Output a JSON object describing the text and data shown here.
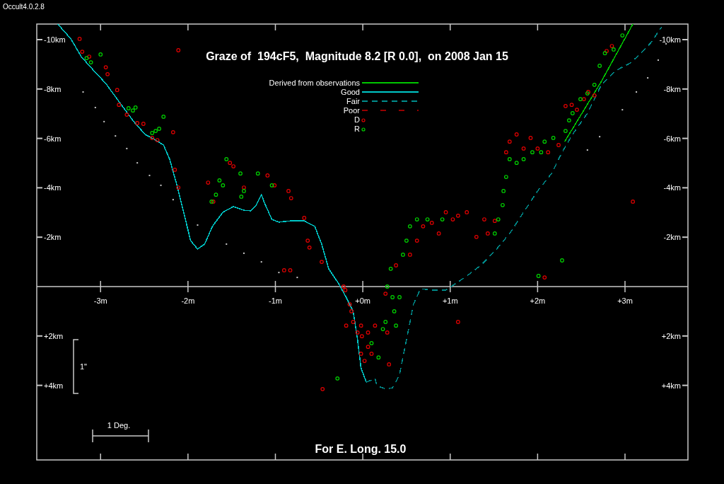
{
  "app_version": "Occult4.0.2.8",
  "charts": [
    {
      "chart_data": {
        "type": "line",
        "title": "Graze of  194cF5,  Magnitude 8.2 [R 0.0],  on 2008 Jan 15",
        "xticks": [
          {
            "value": -3,
            "label": "-3m"
          },
          {
            "value": -2,
            "label": "-2m"
          },
          {
            "value": -1,
            "label": "-1m"
          },
          {
            "value": 0,
            "label": "+0m"
          },
          {
            "value": 1,
            "label": "+1m"
          },
          {
            "value": 2,
            "label": "+2m"
          },
          {
            "value": 3,
            "label": "+3m"
          }
        ],
        "yticks": [
          {
            "value": -10,
            "label": "-10km"
          },
          {
            "value": -8,
            "label": "-8km"
          },
          {
            "value": -6,
            "label": "-6km"
          },
          {
            "value": -4,
            "label": "-4km"
          },
          {
            "value": -2,
            "label": "-2km"
          },
          {
            "value": 2,
            "label": "+2km"
          },
          {
            "value": 4,
            "label": "+4km"
          }
        ],
        "y2ticks": [
          {
            "value": -10,
            "label": "-10km"
          },
          {
            "value": -8,
            "label": "-8km"
          },
          {
            "value": -6,
            "label": "-6km"
          },
          {
            "value": -4,
            "label": "-4km"
          },
          {
            "value": -2,
            "label": "-2km"
          },
          {
            "value": 2,
            "label": "+2km"
          },
          {
            "value": 4,
            "label": "+4km"
          }
        ],
        "xlim": [
          -3.73,
          3.72
        ],
        "ylim": [
          7.02,
          -10.63
        ],
        "y2lim": [
          7.02,
          -10.63
        ],
        "legend": "top",
        "series": [
          {
            "name": "Derived from observations",
            "line_style": "solid",
            "color": "#00c800",
            "x": [
              2.31,
              2.73,
              3.09
            ],
            "values": [
              -5.87,
              -8.31,
              -10.63
            ]
          },
          {
            "name": "Good",
            "line_style": "solid",
            "color": "#00c8c8",
            "x": [
              -3.49,
              -3.34,
              -3.22,
              -3.1,
              -2.94,
              -2.78,
              -2.62,
              -2.49,
              -2.37,
              -2.28,
              -2.21,
              -2.13,
              -2.05,
              -1.97,
              -1.89,
              -1.81,
              -1.72,
              -1.6,
              -1.48,
              -1.36,
              -1.28,
              -1.22,
              -1.16,
              -1.12,
              -1.04,
              -0.96,
              -0.83,
              -0.67,
              -0.55,
              -0.47,
              -0.39,
              -0.28,
              -0.19,
              -0.11,
              -0.06,
              -0.02,
              0.04
            ],
            "values": [
              -10.63,
              -10.03,
              -9.31,
              -8.83,
              -8.22,
              -7.45,
              -6.68,
              -6.16,
              -5.93,
              -5.73,
              -5.16,
              -4.15,
              -3.01,
              -1.86,
              -1.52,
              -1.72,
              -2.44,
              -3.01,
              -3.24,
              -3.09,
              -3.07,
              -3.3,
              -3.72,
              -3.35,
              -2.72,
              -2.61,
              -2.66,
              -2.66,
              -2.44,
              -1.72,
              -0.72,
              -0.14,
              0.43,
              1.0,
              2.15,
              3.3,
              3.87
            ]
          },
          {
            "name": "Fair",
            "line_style": "dashed",
            "color": "#008c8c",
            "x": [
              0.04,
              0.14,
              0.16,
              0.26,
              0.34,
              0.42,
              0.5,
              0.58,
              0.66,
              0.79,
              0.95,
              1.07,
              1.19,
              1.35,
              1.51,
              1.68,
              1.84,
              2.0,
              2.16,
              2.28,
              2.4,
              2.57,
              2.73,
              2.89,
              3.05,
              3.17,
              3.3,
              3.42
            ],
            "values": [
              3.87,
              3.72,
              4.01,
              4.15,
              4.1,
              3.58,
              2.15,
              0.72,
              0.09,
              0.14,
              0.14,
              -0.14,
              -0.43,
              -0.86,
              -1.43,
              -2.15,
              -3.01,
              -3.87,
              -4.58,
              -5.44,
              -6.16,
              -7.02,
              -8.17,
              -8.74,
              -9.03,
              -9.4,
              -9.89,
              -10.52
            ]
          },
          {
            "name": "Poor",
            "line_style": "long-dash",
            "color": "#960000"
          }
        ]
      }
    },
    {
      "chart_data": {
        "type": "scatter",
        "xlim": [
          -3.73,
          3.72
        ],
        "ylim": [
          7.02,
          -10.63
        ],
        "legend": "top",
        "series": [
          {
            "name": "D",
            "marker": "circle",
            "color": "#e00000",
            "x": [
              -3.24,
              -3.21,
              -3.13,
              -2.94,
              -2.92,
              -2.81,
              -2.79,
              -2.7,
              -2.58,
              -2.51,
              -2.41,
              -2.35,
              -2.17,
              -2.11,
              -2.15,
              -2.11,
              -1.77,
              -1.71,
              -1.52,
              -1.48,
              -1.36,
              -1.09,
              -1.01,
              -0.85,
              -0.82,
              -0.67,
              -0.63,
              -0.61,
              -0.47,
              -0.9,
              -0.83,
              -0.22,
              -0.2,
              -0.15,
              -0.13,
              -0.11,
              -0.19,
              -0.02,
              -0.06,
              -0.01,
              0.06,
              0.06,
              -0.02,
              0.02,
              0.1,
              0.14,
              0.26,
              0.28,
              0.3,
              -0.46,
              0.38,
              0.54,
              0.62,
              0.69,
              0.79,
              0.87,
              0.95,
              1.03,
              1.09,
              1.19,
              1.3,
              1.39,
              1.43,
              1.51,
              1.64,
              1.68,
              1.76,
              1.84,
              1.92,
              2.0,
              2.12,
              2.24,
              2.32,
              2.39,
              2.45,
              2.53,
              2.58,
              2.65,
              2.79,
              2.85,
              3.09,
              1.09,
              2.08
            ],
            "values": [
              -10.03,
              -9.51,
              -9.31,
              -8.88,
              -8.6,
              -7.96,
              -7.36,
              -6.96,
              -6.62,
              -6.59,
              -6.02,
              -5.93,
              -6.25,
              -9.57,
              -4.73,
              -4.01,
              -4.21,
              -3.44,
              -5.01,
              -4.87,
              -4.01,
              -4.5,
              -4.1,
              -3.87,
              -3.58,
              -2.78,
              -1.86,
              -1.58,
              -1.0,
              -0.66,
              -0.66,
              0.0,
              0.14,
              0.72,
              1.0,
              1.43,
              1.58,
              1.58,
              1.86,
              2.01,
              1.86,
              2.44,
              2.72,
              3.01,
              2.72,
              1.58,
              0.29,
              1.86,
              3.15,
              4.15,
              -0.86,
              -1.29,
              -1.86,
              -2.44,
              -2.58,
              -2.15,
              -3.01,
              -2.72,
              -2.87,
              -3.01,
              -2.01,
              -2.72,
              -2.15,
              -2.66,
              -5.44,
              -5.87,
              -6.16,
              -5.59,
              -6.02,
              -5.59,
              -5.44,
              -5.73,
              -7.31,
              -7.36,
              -7.16,
              -7.59,
              -7.88,
              -7.74,
              -9.54,
              -9.74,
              -3.44,
              1.43,
              -0.37
            ]
          },
          {
            "name": "R",
            "marker": "circle",
            "color": "#00d200",
            "x": [
              -3.16,
              -3.11,
              -3.0,
              -2.68,
              -2.63,
              -2.6,
              -2.41,
              -2.37,
              -2.33,
              -2.28,
              -1.73,
              -1.68,
              -1.64,
              -1.6,
              -1.56,
              -1.4,
              -1.39,
              -1.36,
              -1.2,
              -1.04,
              0.28,
              0.32,
              0.34,
              0.36,
              0.38,
              0.26,
              0.42,
              0.46,
              0.5,
              0.54,
              0.62,
              0.74,
              0.91,
              1.51,
              1.55,
              1.6,
              1.61,
              1.64,
              1.68,
              1.76,
              1.84,
              1.94,
              2.04,
              2.08,
              2.18,
              2.32,
              2.36,
              2.4,
              2.49,
              2.57,
              2.65,
              2.71,
              2.77,
              2.87,
              2.97,
              2.28,
              2.01,
              0.1,
              0.18,
              0.23,
              -0.29
            ],
            "values": [
              -9.25,
              -9.08,
              -9.4,
              -7.22,
              -7.13,
              -7.25,
              -6.22,
              -6.3,
              -6.39,
              -6.88,
              -3.44,
              -3.72,
              -4.3,
              -4.1,
              -5.16,
              -4.58,
              -3.64,
              -3.87,
              -4.58,
              -4.1,
              0.0,
              -0.72,
              0.43,
              1.0,
              1.58,
              1.43,
              0.43,
              -1.29,
              -1.86,
              -2.44,
              -2.72,
              -2.72,
              -2.72,
              -2.15,
              -2.72,
              -3.3,
              -3.87,
              -4.44,
              -5.16,
              -5.01,
              -5.16,
              -5.44,
              -5.44,
              -5.87,
              -6.02,
              -6.3,
              -6.73,
              -7.02,
              -7.59,
              -7.82,
              -8.17,
              -8.94,
              -9.45,
              -9.6,
              -10.17,
              -1.06,
              -0.43,
              2.29,
              2.87,
              1.72,
              3.72
            ]
          },
          {
            "marker": "square",
            "color": "#c8c8c8",
            "x": [
              -3.2,
              -3.06,
              -2.96,
              -2.83,
              -2.7,
              -2.58,
              -2.44,
              -2.31,
              -2.17,
              -1.89,
              -1.56,
              -1.36,
              -1.16,
              -0.96,
              -0.75,
              3.47,
              3.38,
              3.26,
              3.13,
              2.97,
              2.71,
              2.57
            ],
            "values": [
              -7.88,
              -7.25,
              -6.68,
              -6.1,
              -5.59,
              -5.01,
              -4.5,
              -4.1,
              -3.52,
              -2.49,
              -1.72,
              -1.35,
              -1.0,
              -0.57,
              -0.37,
              -9.83,
              -9.17,
              -8.45,
              -7.88,
              -7.16,
              -6.07,
              -5.53
            ]
          }
        ]
      }
    }
  ],
  "scale_bars": [
    {
      "kind": "vertical",
      "label": "1\""
    },
    {
      "kind": "horizontal",
      "label": "1 Deg."
    }
  ],
  "footer": "For E. Long. 15.0"
}
